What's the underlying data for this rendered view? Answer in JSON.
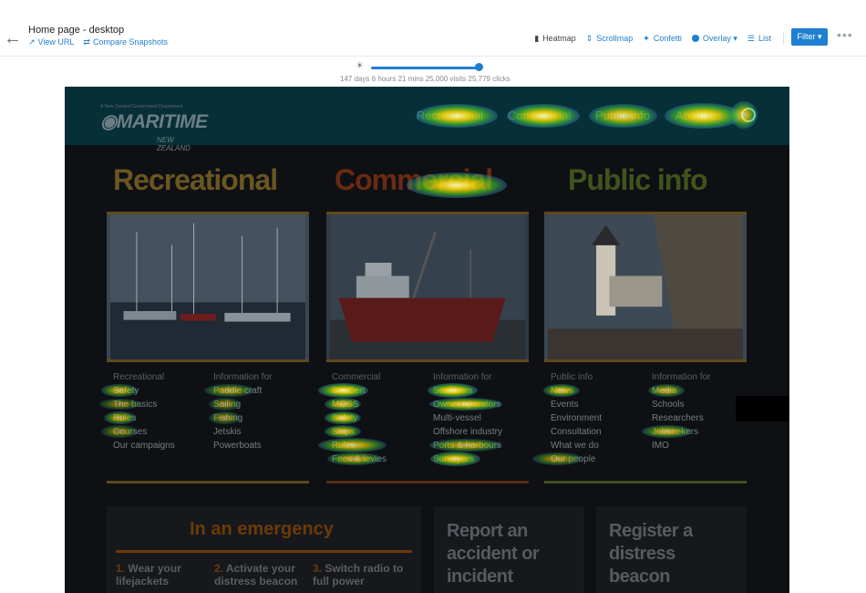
{
  "header": {
    "back_icon": "arrow-left-icon",
    "title": "Home page - desktop",
    "view_url": "View URL",
    "compare": "Compare Snapshots"
  },
  "toolbar": {
    "heatmap": "Heatmap",
    "scrollmap": "Scrollmap",
    "confetti": "Confetti",
    "overlay": "Overlay",
    "list": "List",
    "filter": "Filter",
    "more_icon": "more-dots-icon"
  },
  "slider": {
    "value": 1.0,
    "stats": "147 days 6 hours 21 mins   25,000 visits   25,779 clicks"
  },
  "site": {
    "logo_tag": "A New Zealand Government Department",
    "logo_main": "MARITIME",
    "logo_sub": "NEW ZEALAND",
    "nav": [
      "Recreational",
      "Commercial",
      "Public info",
      "About us"
    ],
    "columns": [
      {
        "title": "Recreational",
        "color": "#6a5620"
      },
      {
        "title": "Commercial",
        "color": "#6a2b12"
      },
      {
        "title": "Public info",
        "color": "#41531c"
      }
    ],
    "lists": {
      "rec_head": "Recreational",
      "rec": [
        "Safety",
        "The basics",
        "Rules",
        "Courses",
        "Our campaigns"
      ],
      "recinfo_head": "Information for",
      "recinfo": [
        "Paddle craft",
        "Sailing",
        "Fishing",
        "Jetskis",
        "Powerboats"
      ],
      "com_head": "Commercial",
      "com": [
        "SeaCert",
        "MOSS",
        "Safety",
        "Ships",
        "Rules",
        "Fees & levies"
      ],
      "cominfo_head": "Information for",
      "cominfo": [
        "Seafarers",
        "Owner operators",
        "Multi-vessel",
        "Offshore industry",
        "Ports & harbours",
        "Surveyors"
      ],
      "pub_head": "Public info",
      "pub": [
        "News",
        "Events",
        "Environment",
        "Consultation",
        "What we do",
        "Our people"
      ],
      "pubinfo_head": "Information for",
      "pubinfo": [
        "Media",
        "Schools",
        "Researchers",
        "Jobseekers",
        "IMO"
      ]
    },
    "emergency": {
      "title": "In an emergency",
      "steps": [
        {
          "num": "1.",
          "text": "Wear your lifejackets"
        },
        {
          "num": "2.",
          "text": "Activate your distress beacon"
        },
        {
          "num": "3.",
          "text": "Switch radio to full power"
        }
      ]
    },
    "card2": "Report an accident or incident",
    "card3": "Register a distress beacon"
  }
}
